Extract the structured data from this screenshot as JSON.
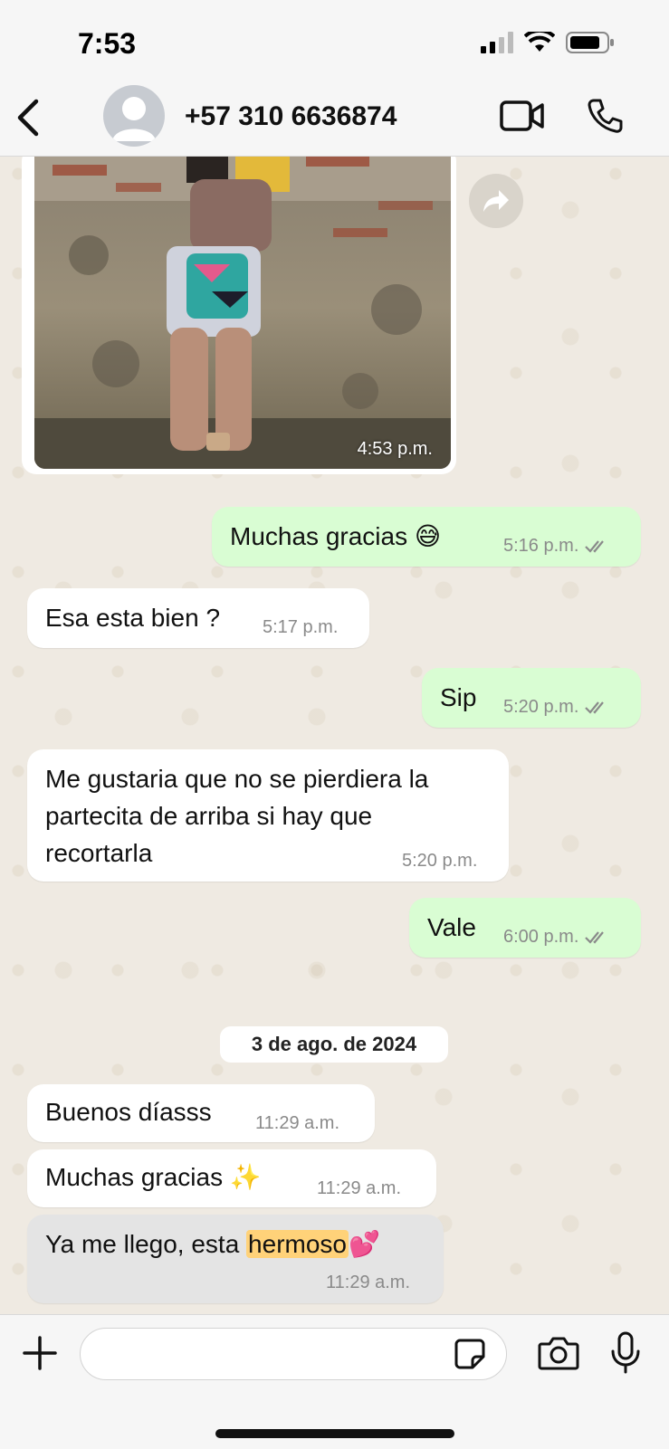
{
  "status": {
    "time": "7:53"
  },
  "header": {
    "contact": "+57 310 6636874"
  },
  "image_message": {
    "time": "4:53 p.m."
  },
  "messages": [
    {
      "text": "Muchas gracias 😅",
      "time": "5:16 p.m."
    },
    {
      "text": "Esa esta bien ?",
      "time": "5:17 p.m."
    },
    {
      "text": "Sip",
      "time": "5:20 p.m."
    },
    {
      "line1": "Me gustaria que no se pierdiera la",
      "line2": "partecita de arriba si hay que",
      "line3": "recortarla",
      "time": "5:20 p.m."
    },
    {
      "text": "Vale",
      "time": "6:00 p.m."
    },
    {
      "text": "Buenos díasss",
      "time": "11:29 a.m."
    },
    {
      "text": "Muchas gracias ✨",
      "time": "11:29 a.m."
    },
    {
      "before": "Ya me llego, esta ",
      "highlight": "hermoso",
      "after": "💕",
      "time": "11:29 a.m."
    }
  ],
  "date_separator": "3 de ago. de 2024",
  "composer": {
    "placeholder": ""
  },
  "colors": {
    "outgoing": "#d9fdd3",
    "incoming": "#ffffff",
    "highlighted_bubble": "#e4e4e4",
    "search_highlight": "#ffd279"
  }
}
